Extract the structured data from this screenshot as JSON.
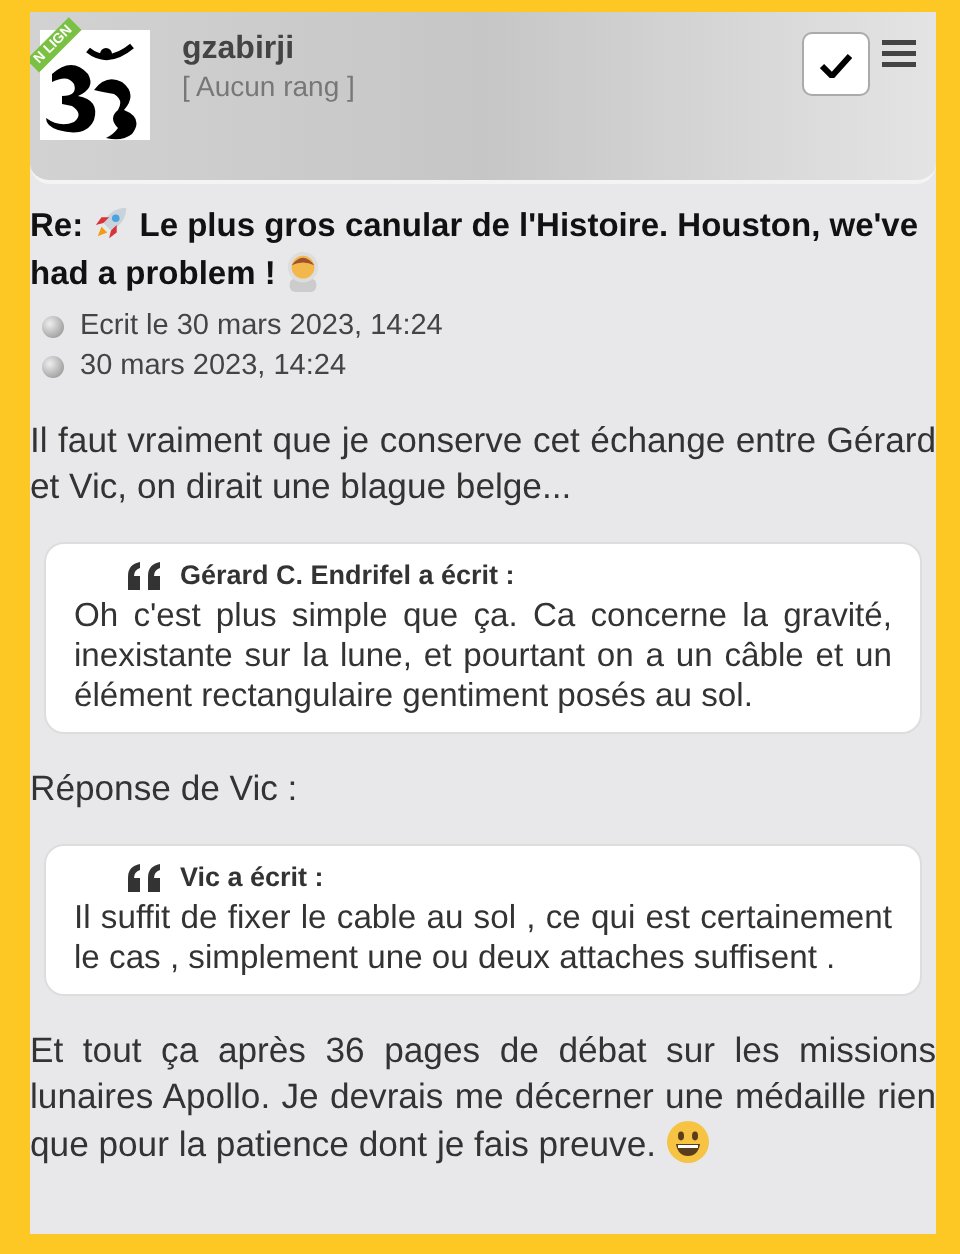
{
  "user": {
    "name": "gzabirji",
    "rank": "[ Aucun rang ]",
    "ribbon": "N LIGN"
  },
  "post": {
    "prefix": "Re:",
    "title": "Le plus gros canular de l'Histoire. Houston, we've had a problem !",
    "meta": [
      "Ecrit le 30 mars 2023, 14:24",
      "30 mars 2023, 14:24"
    ],
    "content": [
      {
        "kind": "text",
        "text": "Il faut vraiment que je conserve cet échange entre Gérard et Vic, on dirait une blague belge..."
      },
      {
        "kind": "quote",
        "author": "Gérard C. Endrifel a écrit :",
        "text": "Oh c'est plus simple que ça. Ca concerne la gravité, inexistante sur la lune, et pourtant on a un câble et un élément rectangulaire gentiment posés au sol."
      },
      {
        "kind": "text",
        "text": "Réponse de Vic :"
      },
      {
        "kind": "quote",
        "author": "Vic a écrit :",
        "text": "Il suffit de fixer le cable au sol , ce qui est certainement le cas , simplement une ou deux attaches suffisent ."
      },
      {
        "kind": "text",
        "text": "Et tout ça après 36 pages de débat sur les missions lunaires Apollo. Je devrais me décerner une médaille rien que pour la patience dont je fais preuve.",
        "smiley": true
      }
    ]
  }
}
